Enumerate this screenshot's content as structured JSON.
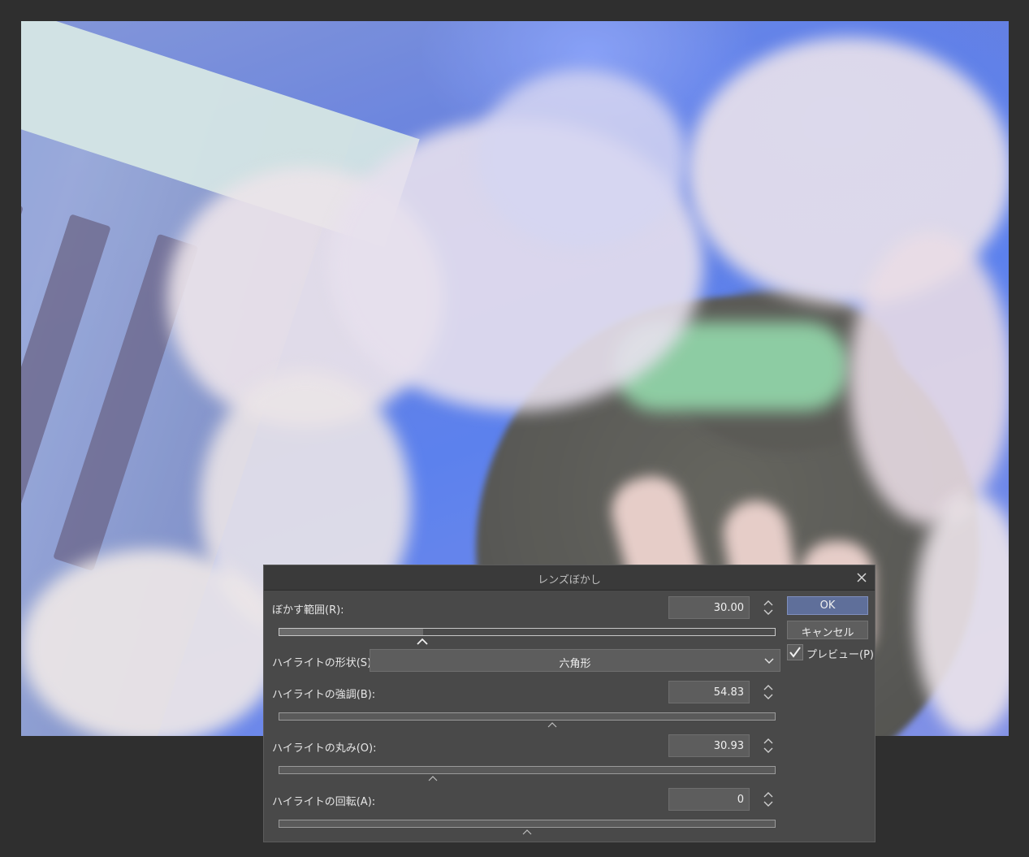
{
  "dialog": {
    "title": "レンズぼかし",
    "close_icon": "close-icon",
    "blur_range": {
      "label": "ぼかす範囲(R):",
      "value": "30.00",
      "level": 0.29
    },
    "highlight_shape": {
      "label": "ハイライトの形状(S):",
      "selected": "六角形"
    },
    "highlight_emphasis": {
      "label": "ハイライトの強調(B):",
      "value": "54.83",
      "level": 0.55
    },
    "highlight_roundness": {
      "label": "ハイライトの丸み(O):",
      "value": "30.93",
      "level": 0.31
    },
    "highlight_rotation": {
      "label": "ハイライトの回転(A):",
      "value": "0",
      "level": 0.5
    },
    "buttons": {
      "ok": "OK",
      "cancel": "キャンセル"
    },
    "preview": {
      "label": "プレビュー(P)",
      "checked": true
    }
  },
  "colors": {
    "dialog_bg": "#494949",
    "titlebar_bg": "#3a3a3a",
    "ok_button": "#5f6f9a"
  }
}
